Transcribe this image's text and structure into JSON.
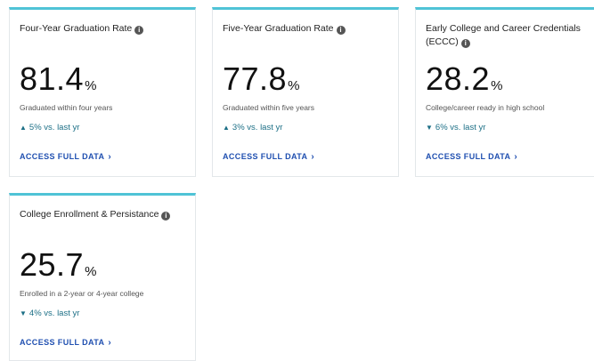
{
  "cards": [
    {
      "title": "Four-Year Graduation Rate",
      "value": "81.4",
      "unit": "%",
      "description": "Graduated within four years",
      "delta_arrow": "▲",
      "delta": "5% vs. last yr",
      "link": "ACCESS FULL DATA"
    },
    {
      "title": "Five-Year Graduation Rate",
      "value": "77.8",
      "unit": "%",
      "description": "Graduated within five years",
      "delta_arrow": "▲",
      "delta": "3% vs. last yr",
      "link": "ACCESS FULL DATA"
    },
    {
      "title": "Early College and Career Credentials (ECCC)",
      "value": "28.2",
      "unit": "%",
      "description": "College/career ready in high school",
      "delta_arrow": "▼",
      "delta": "6% vs. last yr",
      "link": "ACCESS FULL DATA"
    },
    {
      "title": "College Enrollment & Persistance",
      "value": "25.7",
      "unit": "%",
      "description": "Enrolled in a 2-year or 4-year college",
      "delta_arrow": "▼",
      "delta": "4% vs. last yr",
      "link": "ACCESS FULL DATA"
    }
  ],
  "icons": {
    "info": "info-icon",
    "chevron": "chevron-right-icon"
  },
  "colors": {
    "accent_bar": "#4fc3d6",
    "delta_text": "#1c6f86",
    "link_text": "#1f4fb0"
  }
}
